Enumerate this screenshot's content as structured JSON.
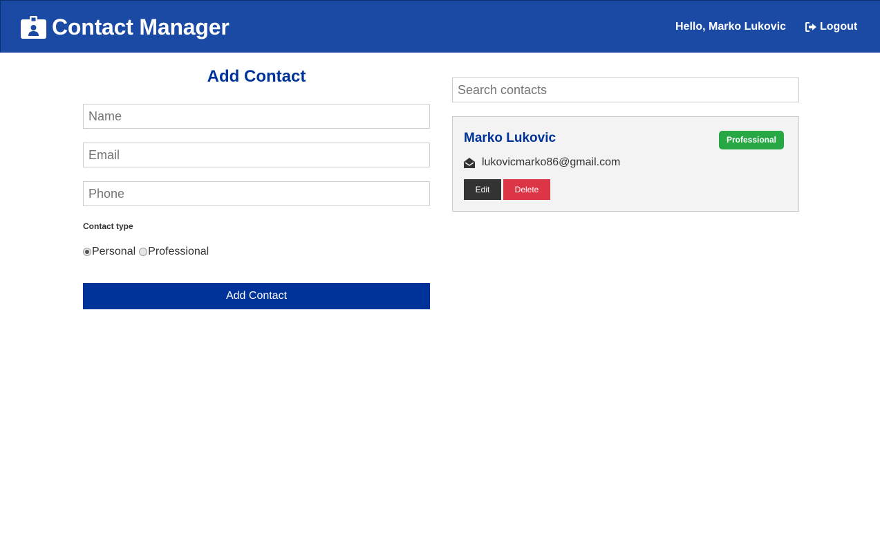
{
  "navbar": {
    "title": "Contact Manager",
    "brand_icon": "id-badge-icon",
    "greeting": "Hello, Marko Lukovic",
    "logout_label": "Logout",
    "logout_icon": "sign-out-icon",
    "background": "#1a4aa3"
  },
  "form": {
    "title": "Add Contact",
    "name_placeholder": "Name",
    "email_placeholder": "Email",
    "phone_placeholder": "Phone",
    "name_value": "",
    "email_value": "",
    "phone_value": "",
    "contact_type_label": "Contact type",
    "types": [
      {
        "label": "Personal",
        "checked": true
      },
      {
        "label": "Professional",
        "checked": false
      }
    ],
    "submit_label": "Add Contact",
    "accent": "#003399"
  },
  "search": {
    "placeholder": "Search contacts",
    "value": ""
  },
  "contacts": [
    {
      "name": "Marko Lukovic",
      "type": "Professional",
      "email": "lukovicmarko86@gmail.com",
      "email_icon": "envelope-open-icon",
      "edit_label": "Edit",
      "delete_label": "Delete",
      "badge_color": "#28a745"
    }
  ]
}
